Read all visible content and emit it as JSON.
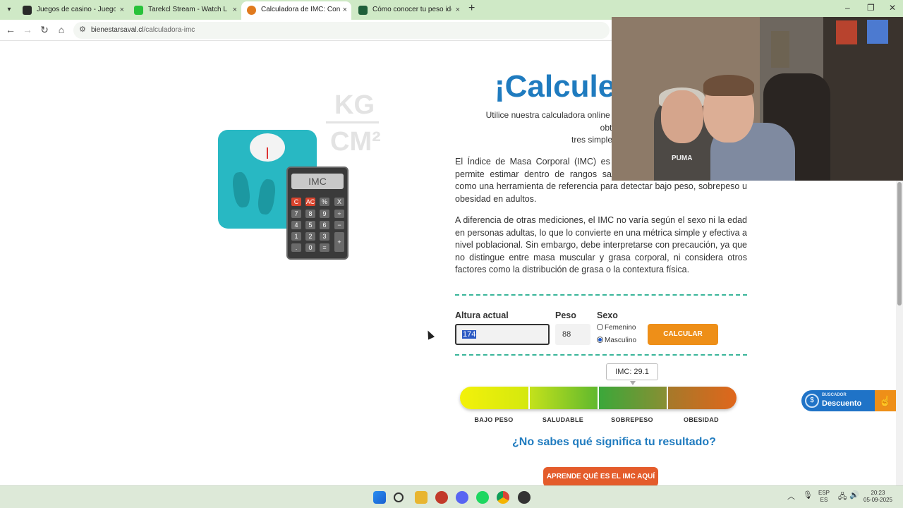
{
  "browser": {
    "tabs": [
      {
        "label": "Juegos de casino - Juegos de c",
        "active": false,
        "fav_color": "#2a2a2a"
      },
      {
        "label": "Tarekcl Stream - Watch Live on",
        "active": false,
        "fav_color": "#28c23a"
      },
      {
        "label": "Calculadora de IMC: Conoce tu",
        "active": true,
        "fav_color": "#e07a1e"
      },
      {
        "label": "Cómo conocer tu peso ideal",
        "active": false,
        "fav_color": "#1f5f3a"
      }
    ],
    "close_glyph": "×",
    "new_tab_glyph": "+",
    "url_domain": "bienestarsaval.cl",
    "url_path": "/calculadora-imc",
    "window_controls": [
      "–",
      "❐",
      "✕"
    ]
  },
  "illustration": {
    "kg": "KG",
    "cm": "CM²",
    "calc_screen": "IMC",
    "keys": [
      "C",
      "AC",
      "%",
      "X",
      "7",
      "8",
      "9",
      "÷",
      "4",
      "5",
      "6",
      "−",
      "1",
      "2",
      "3",
      "+",
      ".",
      "0",
      "="
    ]
  },
  "content": {
    "heading": "¡Calcule",
    "subtitle_line1": "Utilice nuestra calculadora online y obte",
    "subtitle_line2": "tres simples",
    "para1": "El Índice de Masa Corporal (IMC) es una estatura de una persona, y permite estimar dentro de rangos saludables. Se utiliza ampliamente como una herramienta de referencia para detectar bajo peso, sobrepeso u obesidad en adultos.",
    "para2": "A diferencia de otras mediciones, el IMC no varía según el sexo ni la edad en personas adultas, lo que lo convierte en una métrica simple y efectiva a nivel poblacional. Sin embargo, debe interpretarse con precaución, ya que no distingue entre masa muscular y grasa corporal, ni considera otros factores como la distribución de grasa o la contextura física."
  },
  "form": {
    "altura_label": "Altura actual",
    "altura_value": "174",
    "peso_label": "Peso",
    "peso_value": "88",
    "sexo_label": "Sexo",
    "option_femenino": "Femenino",
    "option_masculino": "Masculino",
    "selected": "Masculino",
    "calcular_label": "CALCULAR"
  },
  "result": {
    "imc_text": "IMC: 29.1",
    "categories": [
      "BAJO PESO",
      "SALUDABLE",
      "SOBREPESO",
      "OBESIDAD"
    ],
    "question": "¿No sabes qué significa tu resultado?",
    "learn_button": "APRENDE QUÉ ES EL IMC AQUÍ"
  },
  "discount_widget": {
    "small": "BUSCADOR",
    "big": "Descuento"
  },
  "webcam": {
    "shirt_logo": "PUMA"
  },
  "taskbar": {
    "lang_line1": "ESP",
    "lang_line2": "ES",
    "time": "20:23",
    "date": "05-09-2025"
  },
  "colors": {
    "accent_blue": "#1f7bbf",
    "accent_orange": "#ee8f18",
    "teal_divider": "#3ab59a",
    "learn_button": "#e45c2b"
  }
}
